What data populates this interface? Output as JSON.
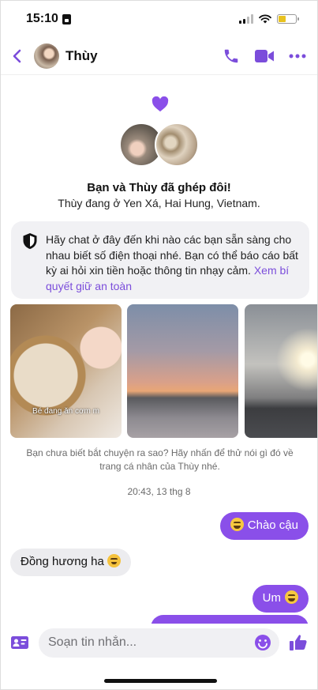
{
  "status_bar": {
    "time": "15:10"
  },
  "header": {
    "contact_name": "Thùy"
  },
  "match": {
    "title": "Bạn và Thùy đã ghép đôi!",
    "subtitle": "Thùy đang ở Yen Xá, Hai Hung, Vietnam."
  },
  "safety": {
    "text": "Hãy chat ở đây đến khi nào các bạn sẵn sàng cho nhau biết số điện thoại nhé. Bạn có thể báo cáo bất kỳ ai hỏi xin tiền hoặc thông tin nhạy cảm. ",
    "link": "Xem bí quyết giữ an toàn"
  },
  "photos": [
    {
      "caption": "Bé đang ăn cơm m"
    },
    {
      "caption": ""
    },
    {
      "caption": ""
    }
  ],
  "hint": "Bạn chưa biết bắt chuyện ra sao? Hãy nhấn để thử nói gì đó về trang cá nhân của Thùy nhé.",
  "timestamp": "20:43, 13 thg 8",
  "messages": [
    {
      "side": "out",
      "text": "Chào cậu"
    },
    {
      "side": "in",
      "text": "Đồng hương ha"
    },
    {
      "side": "out",
      "text": "Um"
    }
  ],
  "composer": {
    "placeholder": "Soạn tin nhắn..."
  },
  "colors": {
    "accent": "#8a4fe9",
    "incoming_bubble": "#ececef"
  }
}
